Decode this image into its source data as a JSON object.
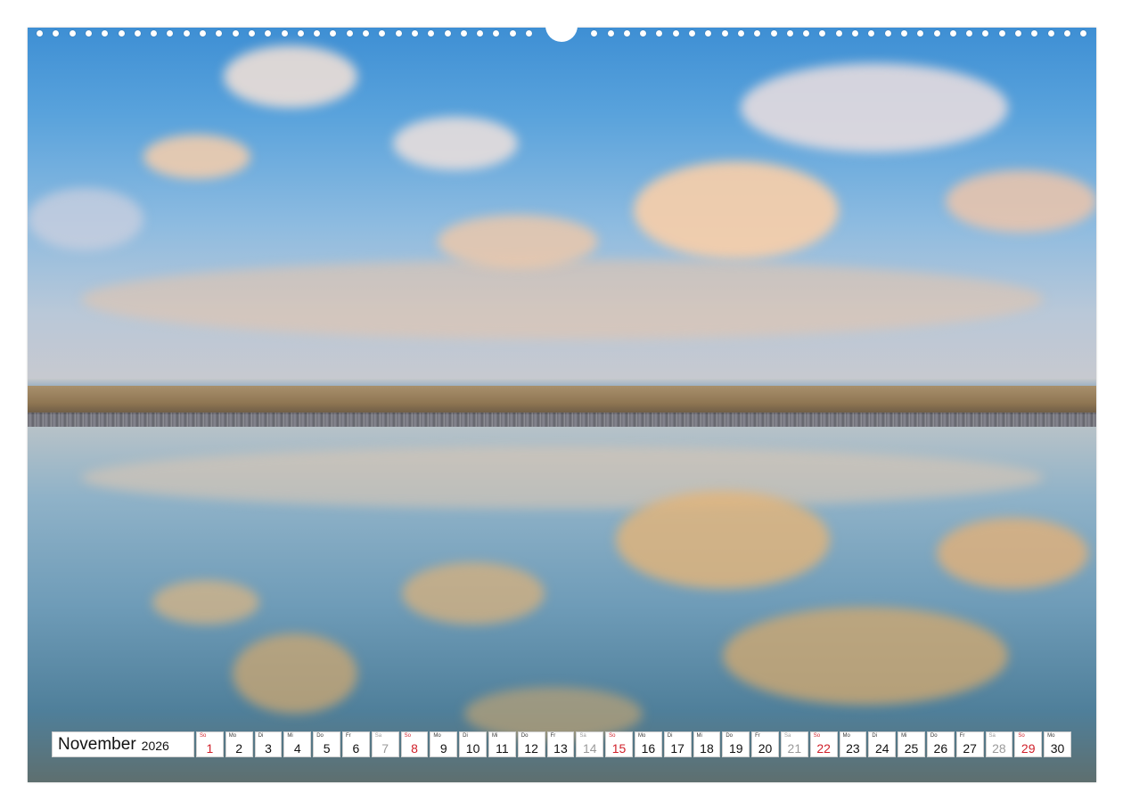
{
  "calendar": {
    "month": "November",
    "year": "2026",
    "days": [
      {
        "wd": "So",
        "n": "1",
        "type": "sun"
      },
      {
        "wd": "Mo",
        "n": "2",
        "type": "wk"
      },
      {
        "wd": "Di",
        "n": "3",
        "type": "wk"
      },
      {
        "wd": "Mi",
        "n": "4",
        "type": "wk"
      },
      {
        "wd": "Do",
        "n": "5",
        "type": "wk"
      },
      {
        "wd": "Fr",
        "n": "6",
        "type": "wk"
      },
      {
        "wd": "Sa",
        "n": "7",
        "type": "sat"
      },
      {
        "wd": "So",
        "n": "8",
        "type": "sun"
      },
      {
        "wd": "Mo",
        "n": "9",
        "type": "wk"
      },
      {
        "wd": "Di",
        "n": "10",
        "type": "wk"
      },
      {
        "wd": "Mi",
        "n": "11",
        "type": "wk"
      },
      {
        "wd": "Do",
        "n": "12",
        "type": "wk"
      },
      {
        "wd": "Fr",
        "n": "13",
        "type": "wk"
      },
      {
        "wd": "Sa",
        "n": "14",
        "type": "sat"
      },
      {
        "wd": "So",
        "n": "15",
        "type": "sun"
      },
      {
        "wd": "Mo",
        "n": "16",
        "type": "wk"
      },
      {
        "wd": "Di",
        "n": "17",
        "type": "wk"
      },
      {
        "wd": "Mi",
        "n": "18",
        "type": "wk"
      },
      {
        "wd": "Do",
        "n": "19",
        "type": "wk"
      },
      {
        "wd": "Fr",
        "n": "20",
        "type": "wk"
      },
      {
        "wd": "Sa",
        "n": "21",
        "type": "sat"
      },
      {
        "wd": "So",
        "n": "22",
        "type": "sun"
      },
      {
        "wd": "Mo",
        "n": "23",
        "type": "wk"
      },
      {
        "wd": "Di",
        "n": "24",
        "type": "wk"
      },
      {
        "wd": "Mi",
        "n": "25",
        "type": "wk"
      },
      {
        "wd": "Do",
        "n": "26",
        "type": "wk"
      },
      {
        "wd": "Fr",
        "n": "27",
        "type": "wk"
      },
      {
        "wd": "Sa",
        "n": "28",
        "type": "sat"
      },
      {
        "wd": "So",
        "n": "29",
        "type": "sun"
      },
      {
        "wd": "Mo",
        "n": "30",
        "type": "wk"
      }
    ]
  },
  "colors": {
    "sunday": "#d0202a",
    "saturday": "#9a9a9a",
    "sky": "#4a96d6",
    "sand": "#9a805d"
  }
}
